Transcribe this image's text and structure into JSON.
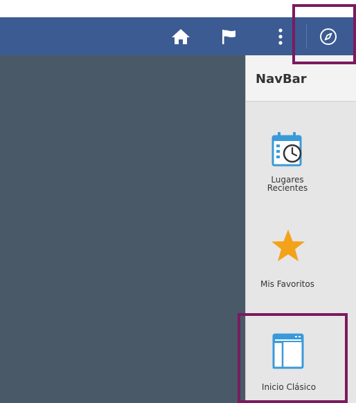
{
  "navbar": {
    "title": "NavBar",
    "tiles": [
      {
        "label_line1": "Lugares",
        "label_line2": "Recientes",
        "icon": "calendar-clock-icon"
      },
      {
        "label": "Mis Favoritos",
        "icon": "star-icon"
      },
      {
        "label": "Inicio Clásico",
        "icon": "classic-home-window-icon"
      }
    ]
  },
  "header_icons": [
    "home-icon",
    "flag-icon",
    "more-vertical-icon",
    "compass-icon"
  ],
  "colors": {
    "header_bg": "#3b5b92",
    "content_bg": "#4a5967",
    "panel_bg": "#e6e6e6",
    "highlight": "#7a1b5f",
    "accent_blue": "#3a9ad9",
    "star_orange": "#f5a21b"
  }
}
